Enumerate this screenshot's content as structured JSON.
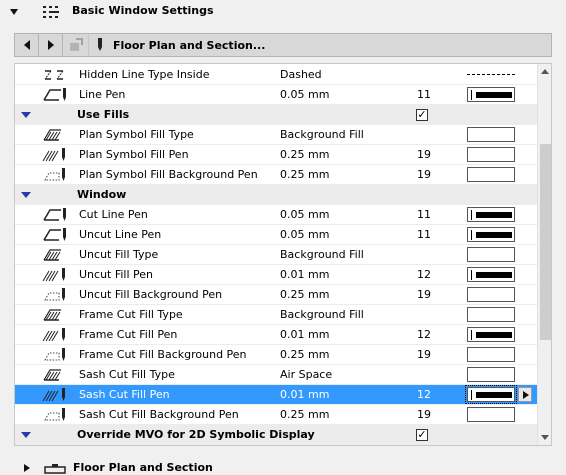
{
  "header": {
    "title": "Basic Window Settings"
  },
  "toolbar": {
    "floorplan_label": "Floor Plan and Section..."
  },
  "rows": [
    {
      "type": "item",
      "icon": "hidden-line-type-icon",
      "name": "Hidden Line Type Inside",
      "value": "Dashed",
      "num": "",
      "swatch": "dashed"
    },
    {
      "type": "item",
      "icon": "line-pen-icon",
      "name": "Line Pen",
      "value": "0.05 mm",
      "num": "11",
      "swatch": "pen"
    },
    {
      "type": "group",
      "name": "Use Fills",
      "checked": true
    },
    {
      "type": "item",
      "icon": "fill-type-icon",
      "name": "Plan Symbol Fill Type",
      "value": "Background Fill",
      "num": "",
      "swatch": "blank"
    },
    {
      "type": "item",
      "icon": "fill-pen-icon",
      "name": "Plan Symbol Fill Pen",
      "value": "0.25 mm",
      "num": "19",
      "swatch": "blank"
    },
    {
      "type": "item",
      "icon": "fill-bg-pen-icon",
      "name": "Plan Symbol Fill Background Pen",
      "value": "0.25 mm",
      "num": "19",
      "swatch": "blank"
    },
    {
      "type": "group",
      "name": "Window",
      "checked": null
    },
    {
      "type": "item",
      "icon": "cut-line-pen-icon",
      "name": "Cut Line Pen",
      "value": "0.05 mm",
      "num": "11",
      "swatch": "pen"
    },
    {
      "type": "item",
      "icon": "uncut-line-pen-icon",
      "name": "Uncut Line Pen",
      "value": "0.05 mm",
      "num": "11",
      "swatch": "pen"
    },
    {
      "type": "item",
      "icon": "fill-type-icon",
      "name": "Uncut Fill Type",
      "value": "Background Fill",
      "num": "",
      "swatch": "blank"
    },
    {
      "type": "item",
      "icon": "fill-pen-icon",
      "name": "Uncut Fill Pen",
      "value": "0.01 mm",
      "num": "12",
      "swatch": "pen"
    },
    {
      "type": "item",
      "icon": "fill-bg-pen-icon",
      "name": "Uncut Fill Background Pen",
      "value": "0.25 mm",
      "num": "19",
      "swatch": "blank"
    },
    {
      "type": "item",
      "icon": "fill-type-icon",
      "name": "Frame Cut Fill Type",
      "value": "Background Fill",
      "num": "",
      "swatch": "blank"
    },
    {
      "type": "item",
      "icon": "fill-pen-icon",
      "name": "Frame Cut Fill Pen",
      "value": "0.01 mm",
      "num": "12",
      "swatch": "pen"
    },
    {
      "type": "item",
      "icon": "fill-bg-pen-icon",
      "name": "Frame Cut Fill Background Pen",
      "value": "0.25 mm",
      "num": "19",
      "swatch": "blank"
    },
    {
      "type": "item",
      "icon": "fill-type-icon",
      "name": "Sash Cut Fill Type",
      "value": "Air Space",
      "num": "",
      "swatch": "blank"
    },
    {
      "type": "item",
      "icon": "fill-pen-icon",
      "name": "Sash Cut Fill Pen",
      "value": "0.01 mm",
      "num": "12",
      "swatch": "pen",
      "selected": true
    },
    {
      "type": "item",
      "icon": "fill-bg-pen-icon",
      "name": "Sash Cut Fill Background Pen",
      "value": "0.25 mm",
      "num": "19",
      "swatch": "blank"
    },
    {
      "type": "group",
      "name": "Override MVO for 2D Symbolic Display",
      "checked": true
    }
  ],
  "checkmark": "✓",
  "bottom": {
    "title": "Floor Plan and Section"
  },
  "colors": {
    "selection": "#3399ff",
    "group_triangle": "#2b3aa8"
  }
}
